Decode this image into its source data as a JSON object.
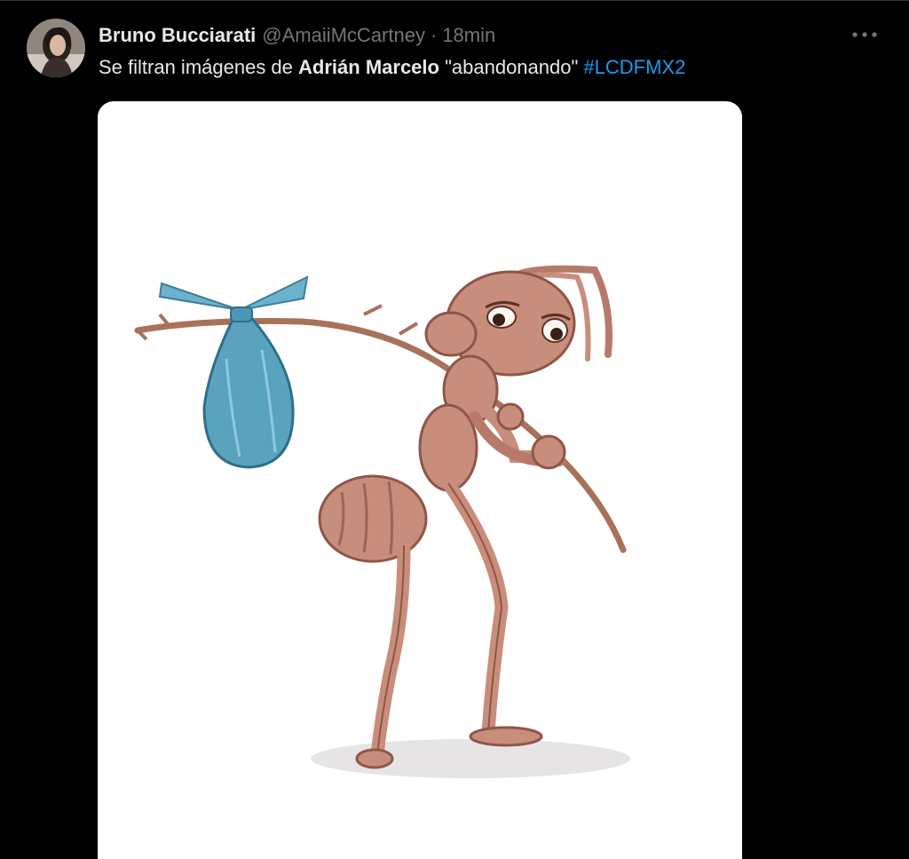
{
  "tweet": {
    "author": {
      "display_name": "Bruno Bucciarati",
      "handle": "@AmaiiMcCartney",
      "separator": "·",
      "time": "18min",
      "avatar_icon": "profile-photo"
    },
    "more_icon": "more-horizontal-icon",
    "text": {
      "part1": "Se filtran imágenes de ",
      "bold": "Adrián Marcelo",
      "part2": " \"abandonando\" ",
      "hashtag": "#LCDFMX2"
    },
    "media": {
      "type": "illustration",
      "subject": "sad ant carrying bindle"
    }
  },
  "colors": {
    "background": "#000000",
    "text_primary": "#e7e9ea",
    "text_secondary": "#71767b",
    "link": "#1d9bf0",
    "media_background": "#ffffff",
    "ant": "#c98d7c",
    "bindle": "#5aa3bf"
  }
}
